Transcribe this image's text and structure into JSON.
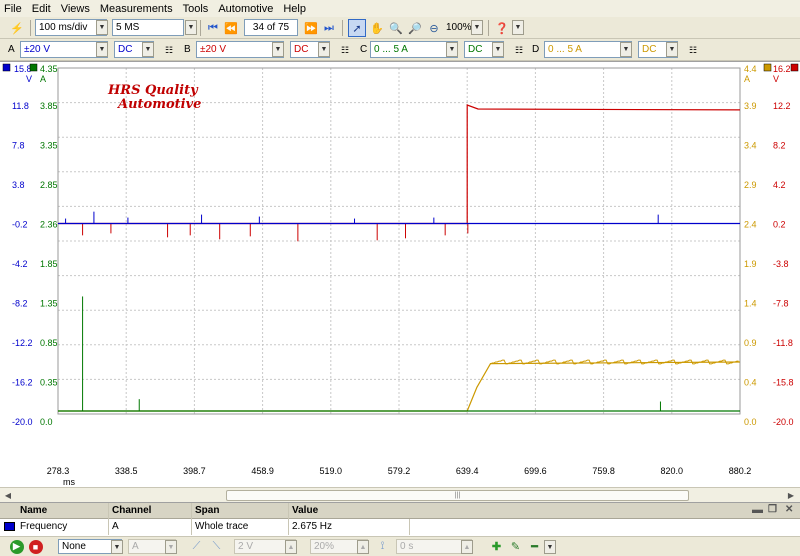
{
  "menu": [
    "File",
    "Edit",
    "Views",
    "Measurements",
    "Tools",
    "Automotive",
    "Help"
  ],
  "toolbar": {
    "timebase": "100 ms/div",
    "samples": "5 MS",
    "buffer_position": "34 of 75",
    "zoom_level": "100%"
  },
  "channels": [
    {
      "letter": "A",
      "range": "±20 V",
      "coupling": "DC",
      "color": "#0000cc"
    },
    {
      "letter": "B",
      "range": "±20 V",
      "coupling": "DC",
      "color": "#cc0000"
    },
    {
      "letter": "C",
      "range": "0 ... 5 A",
      "coupling": "DC",
      "color": "#007700"
    },
    {
      "letter": "D",
      "range": "0 ... 5 A",
      "coupling": "DC",
      "color": "#cc9900"
    }
  ],
  "scope": {
    "watermark_line1": "HRS Quality",
    "watermark_line2": "Automotive",
    "axis_a": {
      "top": "15.8",
      "unit": "V",
      "ticks": [
        "11.8",
        "7.8",
        "3.8",
        "-0.2",
        "-4.2",
        "-8.2",
        "-12.2",
        "-16.2",
        "-20.0"
      ]
    },
    "axis_c": {
      "top": "4.35",
      "unit": "A",
      "ticks": [
        "3.85",
        "3.35",
        "2.85",
        "2.36",
        "1.85",
        "1.35",
        "0.85",
        "0.35",
        "0.0"
      ]
    },
    "axis_d": {
      "top": "4.4",
      "unit": "A",
      "ticks": [
        "3.9",
        "3.4",
        "2.9",
        "2.4",
        "1.9",
        "1.4",
        "0.9",
        "0.4",
        "0.0"
      ]
    },
    "axis_b": {
      "top": "16.2",
      "unit": "V",
      "ticks": [
        "12.2",
        "8.2",
        "4.2",
        "0.2",
        "-3.8",
        "-7.8",
        "-11.8",
        "-15.8",
        "-20.0"
      ]
    },
    "x_ticks": [
      "278.3",
      "338.5",
      "398.7",
      "458.9",
      "519.0",
      "579.2",
      "639.4",
      "699.6",
      "759.8",
      "820.0",
      "880.2"
    ],
    "x_unit": "ms"
  },
  "chart_data": {
    "type": "line",
    "x_range": [
      278.3,
      880.2
    ],
    "x_unit": "ms",
    "series": [
      {
        "name": "A",
        "unit": "V",
        "color": "#0000cc",
        "points": [
          [
            278.3,
            -0.2
          ],
          [
            880.2,
            -0.2
          ]
        ]
      },
      {
        "name": "B",
        "unit": "V",
        "color": "#cc0000",
        "points": [
          [
            278.3,
            -0.2
          ],
          [
            639.4,
            -0.2
          ],
          [
            639.4,
            11.8
          ],
          [
            649,
            11.4
          ],
          [
            880.2,
            11.3
          ]
        ]
      },
      {
        "name": "C",
        "unit": "A",
        "color": "#007700",
        "points": [
          [
            278.3,
            0.0
          ],
          [
            880.2,
            0.0
          ]
        ]
      },
      {
        "name": "D",
        "unit": "A",
        "color": "#cc9900",
        "points": [
          [
            278.3,
            0.0
          ],
          [
            639.4,
            0.0
          ],
          [
            648,
            0.3
          ],
          [
            660,
            0.6
          ],
          [
            880.2,
            0.62
          ]
        ]
      }
    ]
  },
  "measurements": {
    "headers": [
      "Name",
      "Channel",
      "Span",
      "Value"
    ],
    "rows": [
      {
        "name": "Frequency",
        "channel": "A",
        "span": "Whole trace",
        "value": "2.675 Hz"
      }
    ]
  },
  "bottombar": {
    "trigger_mode": "None",
    "trigger_channel": "A",
    "trigger_level": "2 V",
    "pretrigger": "20%",
    "delay": "0 s"
  }
}
